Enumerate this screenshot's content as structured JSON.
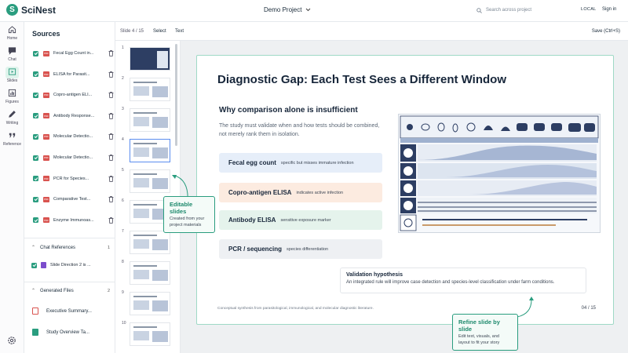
{
  "app": {
    "name": "SciNest",
    "project": "Demo Project"
  },
  "topbar": {
    "search_placeholder": "Search across project",
    "mode_badge": "LOCAL",
    "signin": "Sign in"
  },
  "rail": {
    "items": [
      {
        "label": "Home",
        "icon": "home-icon"
      },
      {
        "label": "Chat",
        "icon": "chat-icon"
      },
      {
        "label": "Slides",
        "icon": "slides-icon",
        "active": true
      },
      {
        "label": "Figures",
        "icon": "figures-icon"
      },
      {
        "label": "Writing",
        "icon": "writing-icon"
      },
      {
        "label": "Reference",
        "icon": "reference-icon"
      }
    ]
  },
  "sources": {
    "title": "Sources",
    "items": [
      {
        "label": "Fecal Egg Count in..."
      },
      {
        "label": "ELISA for Parasit..."
      },
      {
        "label": "Copro-antigen ELI..."
      },
      {
        "label": "Antibody Response..."
      },
      {
        "label": "Molecular Detectio..."
      },
      {
        "label": "Molecular Detectio..."
      },
      {
        "label": "PCR for Species..."
      },
      {
        "label": "Comparative Test..."
      },
      {
        "label": "Enzyme Immunoas..."
      }
    ],
    "chat_references": {
      "title": "Chat References",
      "count": "1",
      "items": [
        "Slide Direction 2 is ..."
      ]
    },
    "generated_files": {
      "title": "Generated Files",
      "count": "2",
      "items": [
        "Executive Summary...",
        "Study Overview Ta..."
      ]
    }
  },
  "editor": {
    "slide_counter": "Slide 4 / 15",
    "tools": {
      "select": "Select",
      "text": "Text"
    },
    "save": "Save (Ctrl+S)",
    "thumb_numbers": [
      "1",
      "2",
      "3",
      "4",
      "5",
      "6",
      "7",
      "8",
      "9",
      "10"
    ]
  },
  "slide": {
    "title": "Diagnostic Gap: Each Test Sees a Different Window",
    "subhead": "Why comparison alone is insufficient",
    "description": "The study must validate when and how tests should be combined, not merely rank them in isolation.",
    "tests": [
      {
        "name": "Fecal egg count",
        "note": "specific but misses immature infection",
        "bg": "#e6eef9"
      },
      {
        "name": "Copro-antigen ELISA",
        "note": "indicates active infection",
        "bg": "#fcebe0"
      },
      {
        "name": "Antibody ELISA",
        "note": "sensitive exposure marker",
        "bg": "#e5f3ec"
      },
      {
        "name": "PCR / sequencing",
        "note": "species differentiation",
        "bg": "#eef0f3"
      }
    ],
    "hypothesis": {
      "title": "Validation hypothesis",
      "text": "An integrated rule will improve case detection and species-level classification under farm conditions."
    },
    "footnote": "Conceptual synthesis from parasitological, immunological, and molecular diagnostic literature.",
    "page": "04 / 15"
  },
  "callouts": {
    "editable": {
      "title": "Editable slides",
      "text": "Created from your project materials"
    },
    "refine": {
      "title": "Refine slide by slide",
      "text": "Edit text, visuals, and layout to fit your story"
    }
  },
  "colors": {
    "accent": "#2a9d7f",
    "figure_navy": "#2d3e63"
  }
}
